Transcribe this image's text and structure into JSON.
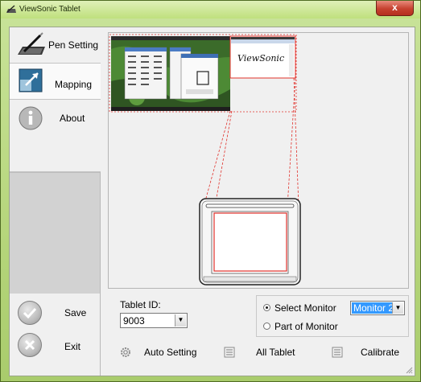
{
  "window": {
    "title": "ViewSonic Tablet",
    "close_label": "x"
  },
  "sidebar": {
    "tabs": [
      {
        "label": "Pen Setting",
        "icon": "pen-tablet-icon"
      },
      {
        "label": "Mapping",
        "icon": "mapping-icon"
      },
      {
        "label": "About",
        "icon": "info-icon"
      }
    ],
    "save_label": "Save",
    "exit_label": "Exit"
  },
  "preview": {
    "monitor1": "desktop-thumbnail",
    "monitor2": "viewsonic-thumbnail",
    "monitor2_text": "ViewSonic",
    "tablet": "tablet-outline"
  },
  "tablet_id": {
    "label": "Tablet ID:",
    "value": "9003"
  },
  "monitor_group": {
    "select_monitor_label": "Select Monitor",
    "part_of_monitor_label": "Part of Monitor",
    "monitor_value": "Monitor 2",
    "selected_option": "Select Monitor"
  },
  "buttons": {
    "auto_setting": "Auto Setting",
    "all_tablet": "All Tablet",
    "calibrate": "Calibrate"
  },
  "colors": {
    "mapping_red": "#e0302a",
    "selection_blue": "#3399ff",
    "window_green": "#b6d67c"
  }
}
